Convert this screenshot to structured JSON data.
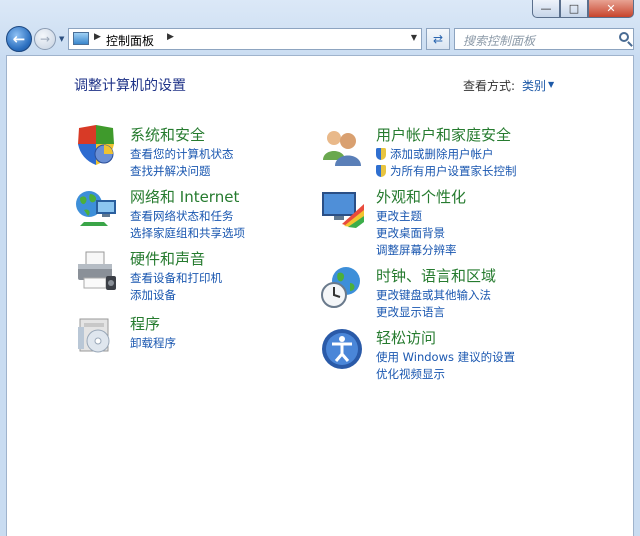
{
  "nav": {
    "address": "控制面板",
    "search_placeholder": "搜索控制面板"
  },
  "caption": {
    "minimize": "—",
    "maximize": "□",
    "close": "✕"
  },
  "header": {
    "title": "调整计算机的设置",
    "view_label": "查看方式:",
    "view_value": "类别"
  },
  "categories": [
    {
      "title": "系统和安全",
      "links": [
        "查看您的计算机状态",
        "查找并解决问题"
      ]
    },
    {
      "title": "网络和 Internet",
      "links": [
        "查看网络状态和任务",
        "选择家庭组和共享选项"
      ]
    },
    {
      "title": "硬件和声音",
      "links": [
        "查看设备和打印机",
        "添加设备"
      ]
    },
    {
      "title": "程序",
      "links": [
        "卸载程序"
      ]
    },
    {
      "title": "用户帐户和家庭安全",
      "links": [
        "添加或删除用户帐户",
        "为所有用户设置家长控制"
      ]
    },
    {
      "title": "外观和个性化",
      "links": [
        "更改主题",
        "更改桌面背景",
        "调整屏幕分辨率"
      ]
    },
    {
      "title": "时钟、语言和区域",
      "links": [
        "更改键盘或其他输入法",
        "更改显示语言"
      ]
    },
    {
      "title": "轻松访问",
      "links": [
        "使用 Windows 建议的设置",
        "优化视频显示"
      ]
    }
  ]
}
